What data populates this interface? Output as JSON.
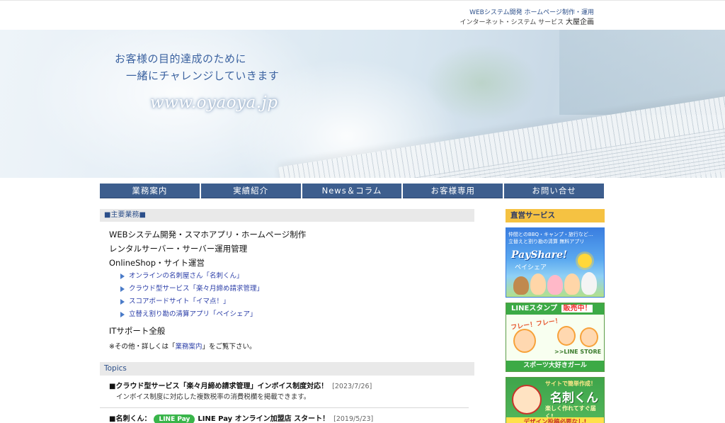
{
  "header": {
    "tagline_line1": "WEBシステム開発 ホームページ制作・運用",
    "tagline_line2": "インターネット・システム サービス",
    "brand": "大屋企画"
  },
  "hero": {
    "line1": "お客様の目的達成のために",
    "line2": "一緒にチャレンジしていきます",
    "url": "www.oyaoya.jp"
  },
  "nav": {
    "items": [
      {
        "label": "業務案内"
      },
      {
        "label": "実績紹介"
      },
      {
        "label": "News＆コラム"
      },
      {
        "label": "お客様専用"
      },
      {
        "label": "お問い合せ"
      }
    ]
  },
  "main": {
    "services_heading": "■主要業務■",
    "services": [
      "WEBシステム開発・スマホアプリ・ホームページ制作",
      "レンタルサーバー・サーバー運用管理",
      "OnlineShop・サイト運営",
      "ITサポート全般"
    ],
    "sub_links": [
      "オンラインの名刺屋さん「名刺くん」",
      "クラウド型サービス「楽々月締め請求管理」",
      "スコアボードサイト「イマ点！」",
      "立替え割り勘の清算アプリ「ペイシェア」"
    ],
    "note_prefix": "※その他・詳しくは「",
    "note_link": "業務案内",
    "note_suffix": "」をご覧下さい。",
    "topics_heading": "Topics",
    "topics": [
      {
        "title": "■クラウド型サービス「楽々月締め請求管理」インボイス制度対応！",
        "date": "[2023/7/26]",
        "body": "インボイス制度に対応した複数税率の消費税欄を掲載できます。"
      },
      {
        "title_prefix": "■名刺くん：",
        "badge": "LINE Pay",
        "title_suffix": "LINE Pay オンライン加盟店 スタート！",
        "date": "[2019/5/23]"
      }
    ]
  },
  "sidebar": {
    "heading": "直営サービス",
    "payshare": {
      "caption_line1": "仲間とのBBQ・キャンプ・旅行など…",
      "caption_line2": "立替えと割り勘の清算  無料アプリ",
      "logo": "PayShare!",
      "kana": "ペイシェア"
    },
    "line_stamp": {
      "title": "LINEスタンプ",
      "hot": "販売中！",
      "cheer": "フレー！フレー！",
      "store": ">>LINE STORE",
      "footer": "スポーツ大好きガール"
    },
    "meishi": {
      "small": "サイトで簡単作成！",
      "big": "名刺くん",
      "sub": "楽しく作れてすぐ届く!",
      "footer": "デザイン投稿必要なし!"
    }
  },
  "colors": {
    "nav_bg": "#3d5e8e",
    "link": "#2c3fa8",
    "heading_text": "#2c4f8a",
    "sidebar_head_bg": "#f5c242",
    "line_green": "#3caa46"
  }
}
